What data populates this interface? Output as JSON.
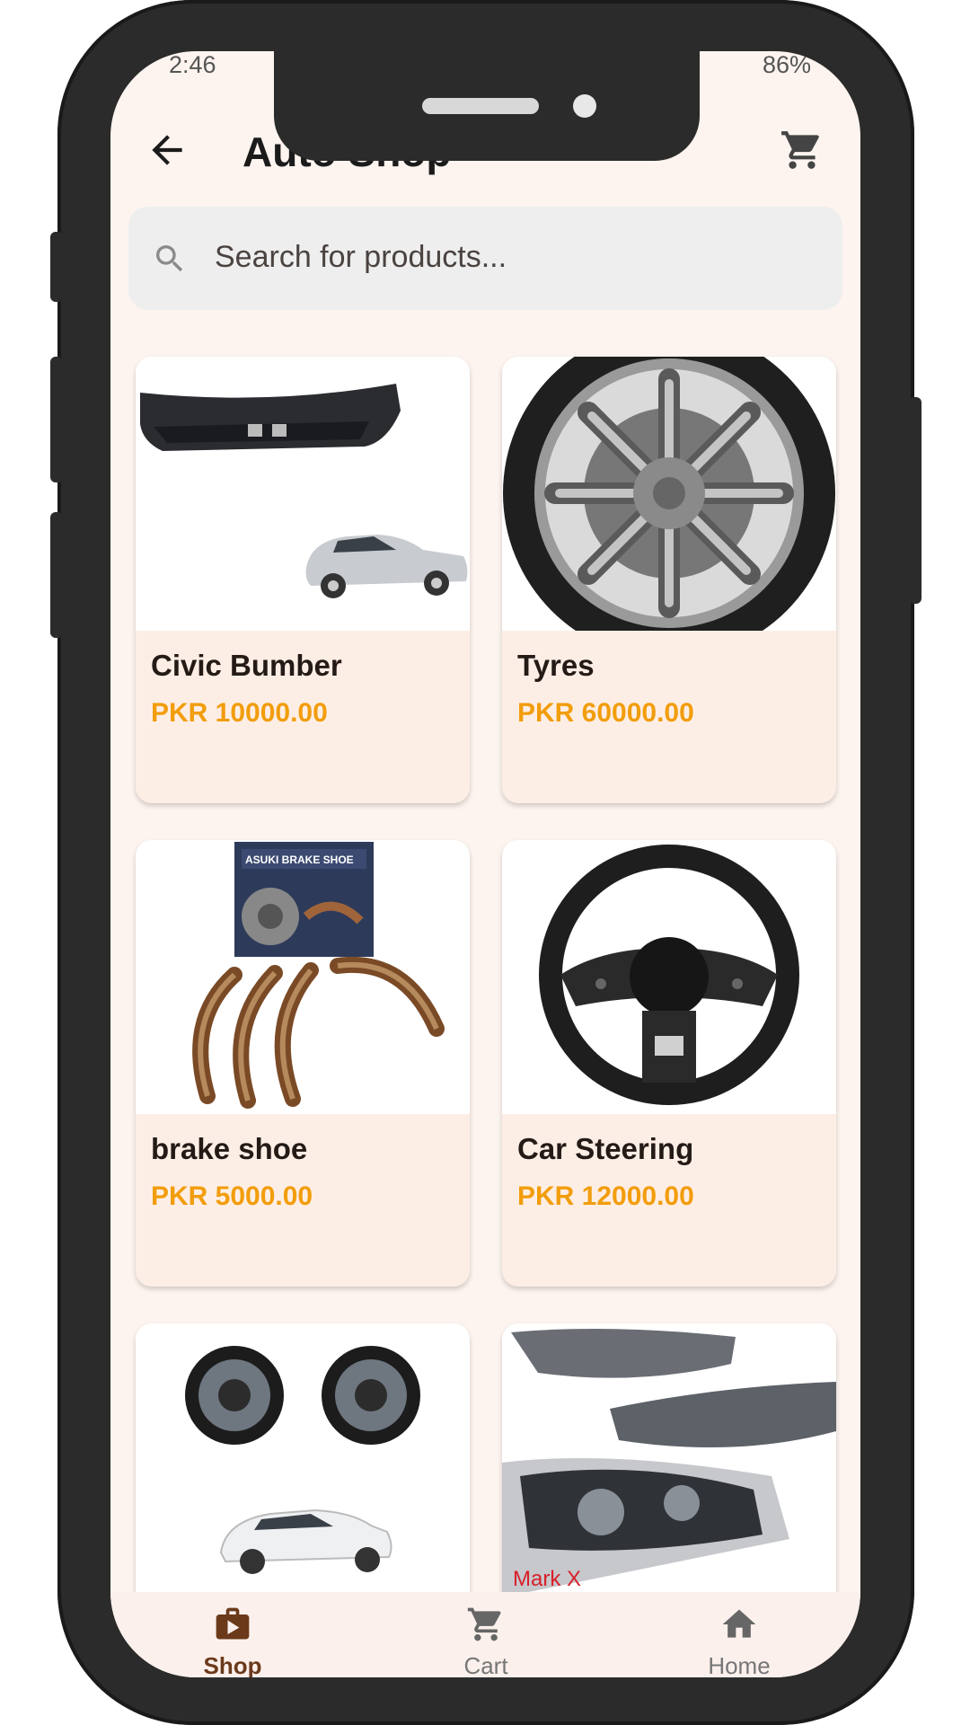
{
  "status": {
    "time": "2:46",
    "battery": "86%"
  },
  "appbar": {
    "title": "Auto Shop"
  },
  "search": {
    "placeholder": "Search for products..."
  },
  "products": [
    {
      "name": "Civic Bumber",
      "price": "PKR 10000.00"
    },
    {
      "name": "Tyres",
      "price": "PKR 60000.00"
    },
    {
      "name": "brake shoe",
      "price": "PKR 5000.00"
    },
    {
      "name": "Car Steering",
      "price": "PKR 12000.00"
    },
    {
      "name": "",
      "price": ""
    },
    {
      "name": "",
      "price": ""
    }
  ],
  "image_text": {
    "brake_box": "ASUKI BRAKE SHOE",
    "headlight": "Mark X"
  },
  "nav": [
    {
      "label": "Shop",
      "icon": "shop-icon",
      "active": true
    },
    {
      "label": "Cart",
      "icon": "cart-icon",
      "active": false
    },
    {
      "label": "Home",
      "icon": "home-icon",
      "active": false
    }
  ],
  "colors": {
    "accent": "#f29d0c",
    "active_nav": "#6b3a1b",
    "background": "#fdf4ef",
    "card": "#fdeee5"
  }
}
